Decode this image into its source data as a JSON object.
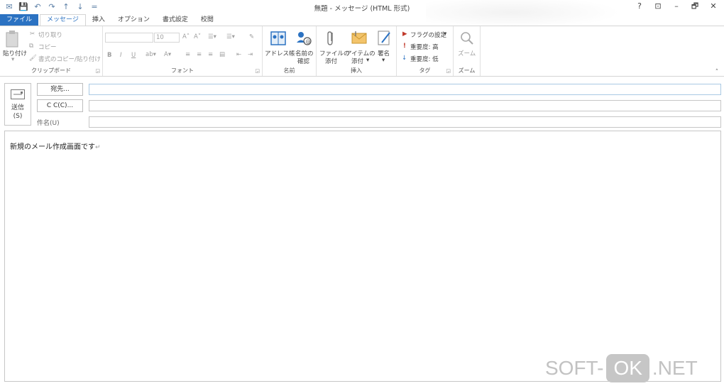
{
  "window": {
    "title": "無題 - メッセージ (HTML 形式)",
    "controls": [
      "?",
      "⊡",
      "–",
      "🗗",
      "✕"
    ]
  },
  "qat": [
    "envelope-icon",
    "save-icon",
    "undo-icon",
    "redo-icon",
    "up-arrow-icon",
    "down-arrow-icon",
    "customize-icon"
  ],
  "tabs": [
    "ファイル",
    "メッセージ",
    "挿入",
    "オプション",
    "書式設定",
    "校閲"
  ],
  "ribbon": {
    "clipboard": {
      "paste": "貼り付け",
      "cut": "切り取り",
      "copy": "コピー",
      "format_painter": "書式のコピー/貼り付け",
      "label": "クリップボード"
    },
    "font": {
      "font_size": "10",
      "bold": "B",
      "italic": "I",
      "underline": "U",
      "label": "フォント"
    },
    "names": {
      "address_book": "アドレス帳",
      "check_names_1": "名前の",
      "check_names_2": "確認",
      "label": "名前"
    },
    "include": {
      "attach_file_1": "ファイルの",
      "attach_file_2": "添付",
      "attach_item_1": "アイテムの",
      "attach_item_2": "添付",
      "signature": "署名",
      "label": "挿入"
    },
    "tags": {
      "follow_up": "フラグの設定",
      "high_importance": "重要度: 高",
      "low_importance": "重要度: 低",
      "label": "タグ"
    },
    "zoom": {
      "zoom": "ズーム",
      "label": "ズーム"
    }
  },
  "header": {
    "send_1": "送信",
    "send_2": "(S)",
    "to_button": "宛先...",
    "cc_button": "C C(C)...",
    "subject_label": "件名(U)"
  },
  "body": {
    "text": "新規のメール作成画面です",
    "pilcrow": "↵"
  },
  "watermark": {
    "left": "SOFT-",
    "ok": "OK",
    "right": ".NET"
  }
}
